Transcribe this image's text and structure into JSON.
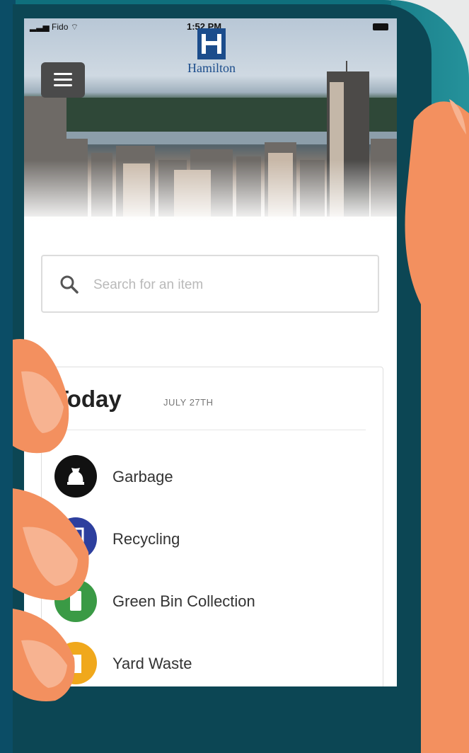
{
  "status_bar": {
    "carrier": "Fido",
    "time": "1:52 PM"
  },
  "header": {
    "logo_text": "Hamilton"
  },
  "search": {
    "placeholder": "Search for an item",
    "value": ""
  },
  "schedule": {
    "title": "Today",
    "date": "JULY 27TH",
    "items": [
      {
        "label": "Garbage",
        "icon": "garbage-bag-icon",
        "color": "#111111"
      },
      {
        "label": "Recycling",
        "icon": "recycling-bin-icon",
        "color": "#2d3f9e"
      },
      {
        "label": "Green Bin Collection",
        "icon": "green-bin-icon",
        "color": "#3a9a45"
      },
      {
        "label": "Yard Waste",
        "icon": "yard-waste-bag-icon",
        "color": "#f0a81c"
      }
    ]
  },
  "colors": {
    "background_teal": "#0f6f7c",
    "phone_body": "#0c4654",
    "skin": "#f3905f"
  }
}
